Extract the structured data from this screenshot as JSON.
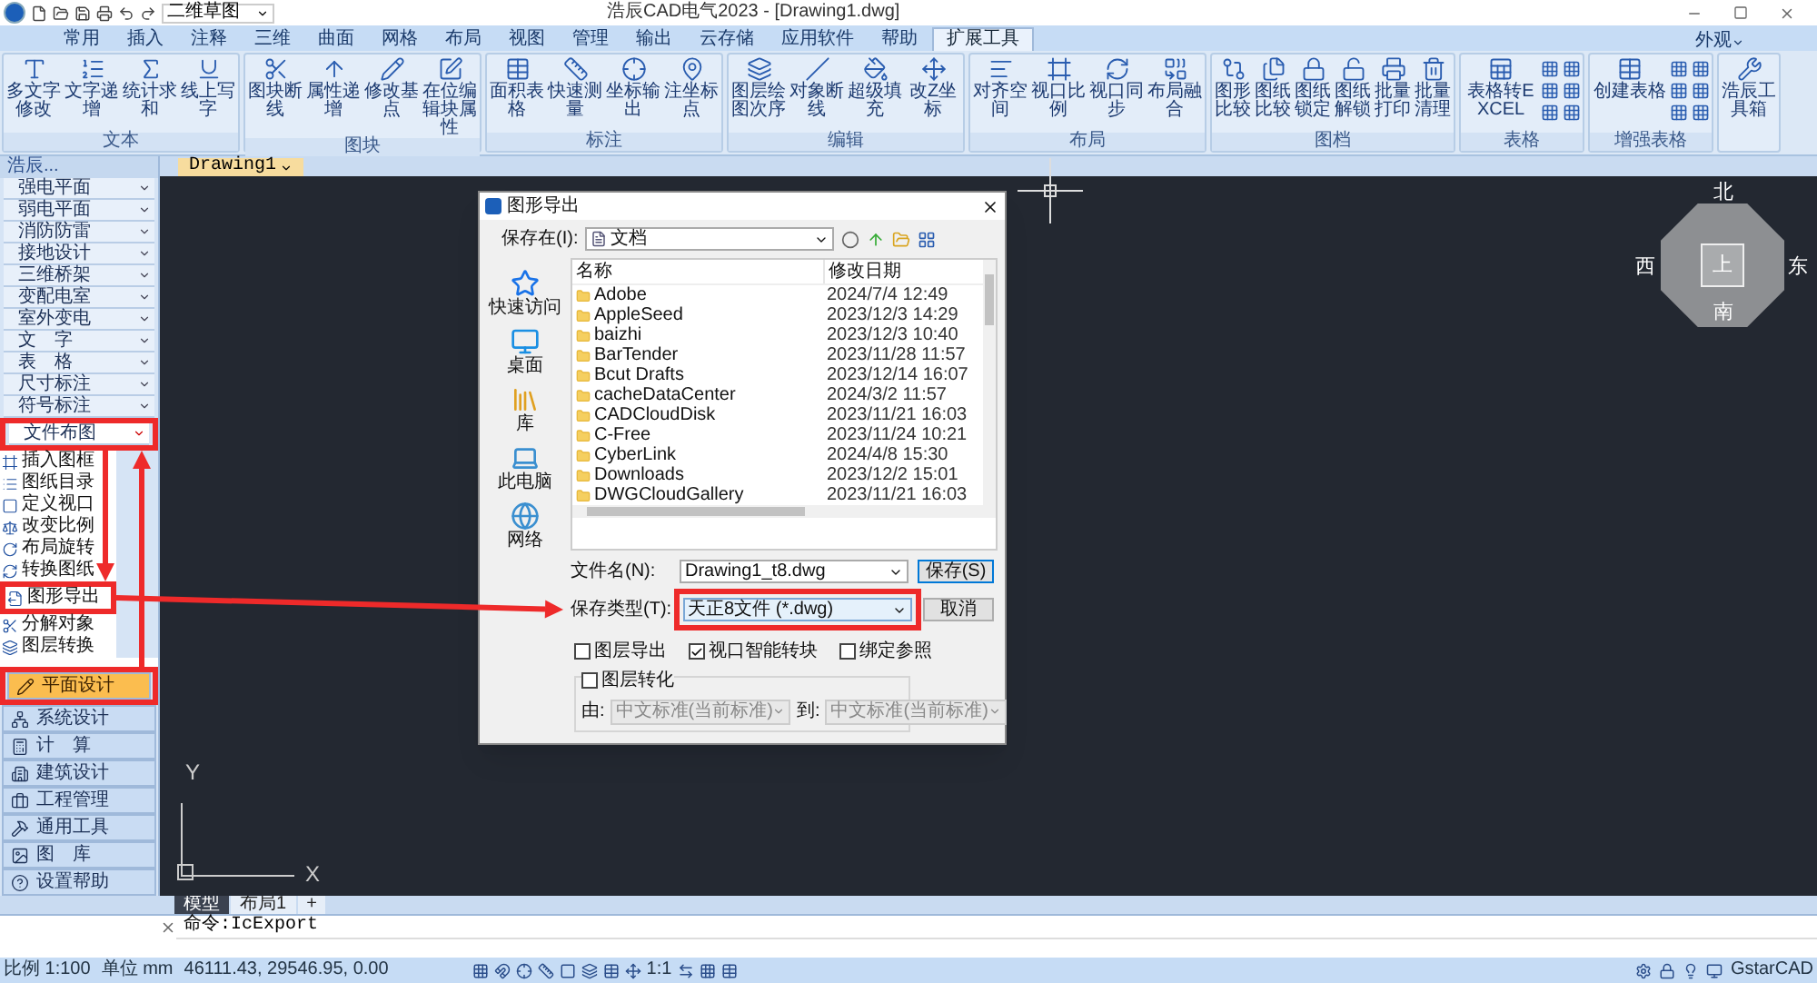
{
  "title_bar": {
    "workspace": "二维草图",
    "title": "浩辰CAD电气2023 - [Drawing1.dwg]"
  },
  "menu_tabs": [
    {
      "label": "常用",
      "selected": false
    },
    {
      "label": "插入",
      "selected": false
    },
    {
      "label": "注释",
      "selected": false
    },
    {
      "label": "三维",
      "selected": false
    },
    {
      "label": "曲面",
      "selected": false
    },
    {
      "label": "网格",
      "selected": false
    },
    {
      "label": "布局",
      "selected": false
    },
    {
      "label": "视图",
      "selected": false
    },
    {
      "label": "管理",
      "selected": false
    },
    {
      "label": "输出",
      "selected": false
    },
    {
      "label": "云存储",
      "selected": false
    },
    {
      "label": "应用软件",
      "selected": false
    },
    {
      "label": "帮助",
      "selected": false
    },
    {
      "label": "扩展工具",
      "selected": true
    }
  ],
  "appearance_menu": "外观",
  "ribbon_groups": [
    {
      "title": "文本",
      "kind": "wide",
      "buttons": [
        "多文字修改",
        "文字递增",
        "统计求和",
        "线上写字"
      ]
    },
    {
      "title": "图块",
      "kind": "wide",
      "buttons": [
        "图块断线",
        "属性递增",
        "修改基点",
        "在位编辑块属性"
      ]
    },
    {
      "title": "标注",
      "kind": "wide",
      "buttons": [
        "面积表格",
        "快速测量",
        "坐标输出",
        "注坐标点"
      ]
    },
    {
      "title": "编辑",
      "kind": "wide",
      "buttons": [
        "图层绘图次序",
        "对象断线",
        "超级填充",
        "改Z坐标"
      ]
    },
    {
      "title": "布局",
      "kind": "wide",
      "buttons": [
        "对齐空间",
        "视口比例",
        "视口同步",
        "布局融合"
      ]
    },
    {
      "title": "图档",
      "kind": "narrow",
      "buttons": [
        "图形比较",
        "图纸比较",
        "图纸锁定",
        "图纸解锁",
        "批量打印",
        "批量清理"
      ]
    },
    {
      "title": "表格",
      "kind": "grid",
      "buttons": [
        "表格转EXCEL"
      ]
    },
    {
      "title": "增强表格",
      "kind": "grid",
      "buttons": [
        "创建表格"
      ]
    },
    {
      "kind": "wide",
      "buttons": [
        "浩辰工具箱"
      ]
    }
  ],
  "drawing_tab": "Drawing1",
  "sidebar": {
    "header": "浩辰...",
    "categories": [
      {
        "label": "强电平面",
        "expanded": false,
        "annotated": false
      },
      {
        "label": "弱电平面",
        "expanded": false,
        "annotated": false
      },
      {
        "label": "消防防雷",
        "expanded": false,
        "annotated": false
      },
      {
        "label": "接地设计",
        "expanded": false,
        "annotated": false
      },
      {
        "label": "三维桥架",
        "expanded": false,
        "annotated": false
      },
      {
        "label": "变配电室",
        "expanded": false,
        "annotated": false
      },
      {
        "label": "室外变电",
        "expanded": false,
        "annotated": false
      },
      {
        "label": "文　字",
        "expanded": false,
        "annotated": false
      },
      {
        "label": "表　格",
        "expanded": false,
        "annotated": false
      },
      {
        "label": "尺寸标注",
        "expanded": false,
        "annotated": false
      },
      {
        "label": "符号标注",
        "expanded": false,
        "annotated": false
      },
      {
        "label": "文件布图",
        "expanded": true,
        "annotated": true,
        "children": [
          {
            "label": "插入图框",
            "annotated": false
          },
          {
            "label": "图纸目录",
            "annotated": false
          },
          {
            "label": "定义视口",
            "annotated": false
          },
          {
            "label": "改变比例",
            "annotated": false
          },
          {
            "label": "布局旋转",
            "annotated": false
          },
          {
            "label": "转换图纸",
            "annotated": false
          },
          {
            "label": "图形导出",
            "annotated": true
          },
          {
            "label": "分解对象",
            "annotated": false
          },
          {
            "label": "图层转换",
            "annotated": false
          }
        ]
      }
    ],
    "modules": [
      {
        "label": "平面设计",
        "selected": true,
        "annotated": true
      },
      {
        "label": "系统设计",
        "selected": false,
        "annotated": false
      },
      {
        "label": "计　算",
        "selected": false,
        "annotated": false
      },
      {
        "label": "建筑设计",
        "selected": false,
        "annotated": false
      },
      {
        "label": "工程管理",
        "selected": false,
        "annotated": false
      },
      {
        "label": "通用工具",
        "selected": false,
        "annotated": false
      },
      {
        "label": "图　库",
        "selected": false,
        "annotated": false
      },
      {
        "label": "设置帮助",
        "selected": false,
        "annotated": false
      }
    ]
  },
  "view_cube": {
    "north": "北",
    "east": "东",
    "south": "南",
    "west": "西",
    "top": "上"
  },
  "ucs": {
    "x": "X",
    "y": "Y"
  },
  "dialog": {
    "title": "图形导出",
    "save_in_label": "保存在(I):",
    "save_in": "文档",
    "places": [
      "快速访问",
      "桌面",
      "库",
      "此电脑",
      "网络"
    ],
    "columns": [
      "名称",
      "修改日期"
    ],
    "files": [
      {
        "name": "Adobe",
        "date": "2024/7/4 12:49"
      },
      {
        "name": "AppleSeed",
        "date": "2023/12/3 14:29"
      },
      {
        "name": "baizhi",
        "date": "2023/12/3 10:40"
      },
      {
        "name": "BarTender",
        "date": "2023/11/28 11:57"
      },
      {
        "name": "Bcut Drafts",
        "date": "2023/12/14 16:07"
      },
      {
        "name": "cacheDataCenter",
        "date": "2024/3/2 11:57"
      },
      {
        "name": "CADCloudDisk",
        "date": "2023/11/21 16:03"
      },
      {
        "name": "C-Free",
        "date": "2023/11/24 10:21"
      },
      {
        "name": "CyberLink",
        "date": "2024/4/8 15:30"
      },
      {
        "name": "Downloads",
        "date": "2023/12/2 15:01"
      },
      {
        "name": "DWGCloudGallery",
        "date": "2023/11/21 16:03"
      }
    ],
    "filename_label": "文件名(N):",
    "filename": "Drawing1_t8.dwg",
    "type_label": "保存类型(T):",
    "type": "天正8文件 (*.dwg)",
    "type_annotated": true,
    "save_button": "保存(S)",
    "cancel_button": "取消",
    "options": [
      {
        "label": "图层导出",
        "checked": false
      },
      {
        "label": "视口智能转块",
        "checked": true
      },
      {
        "label": "绑定参照",
        "checked": false
      }
    ],
    "convert": {
      "label": "图层转化",
      "checked": false,
      "from_label": "由:",
      "from": "中文标准(当前标准)",
      "to_label": "到:",
      "to": "中文标准(当前标准)"
    }
  },
  "layout_tabs": [
    {
      "label": "模型",
      "selected": true
    },
    {
      "label": "布局1",
      "selected": false
    },
    {
      "label": "+",
      "selected": false
    }
  ],
  "command": "命令:IcExport",
  "status": {
    "scale": "比例 1:100",
    "unit": "单位 mm",
    "coords": "46111.43, 29546.95, 0.00",
    "annotation_scale": "1:1",
    "brand": "GstarCAD"
  }
}
